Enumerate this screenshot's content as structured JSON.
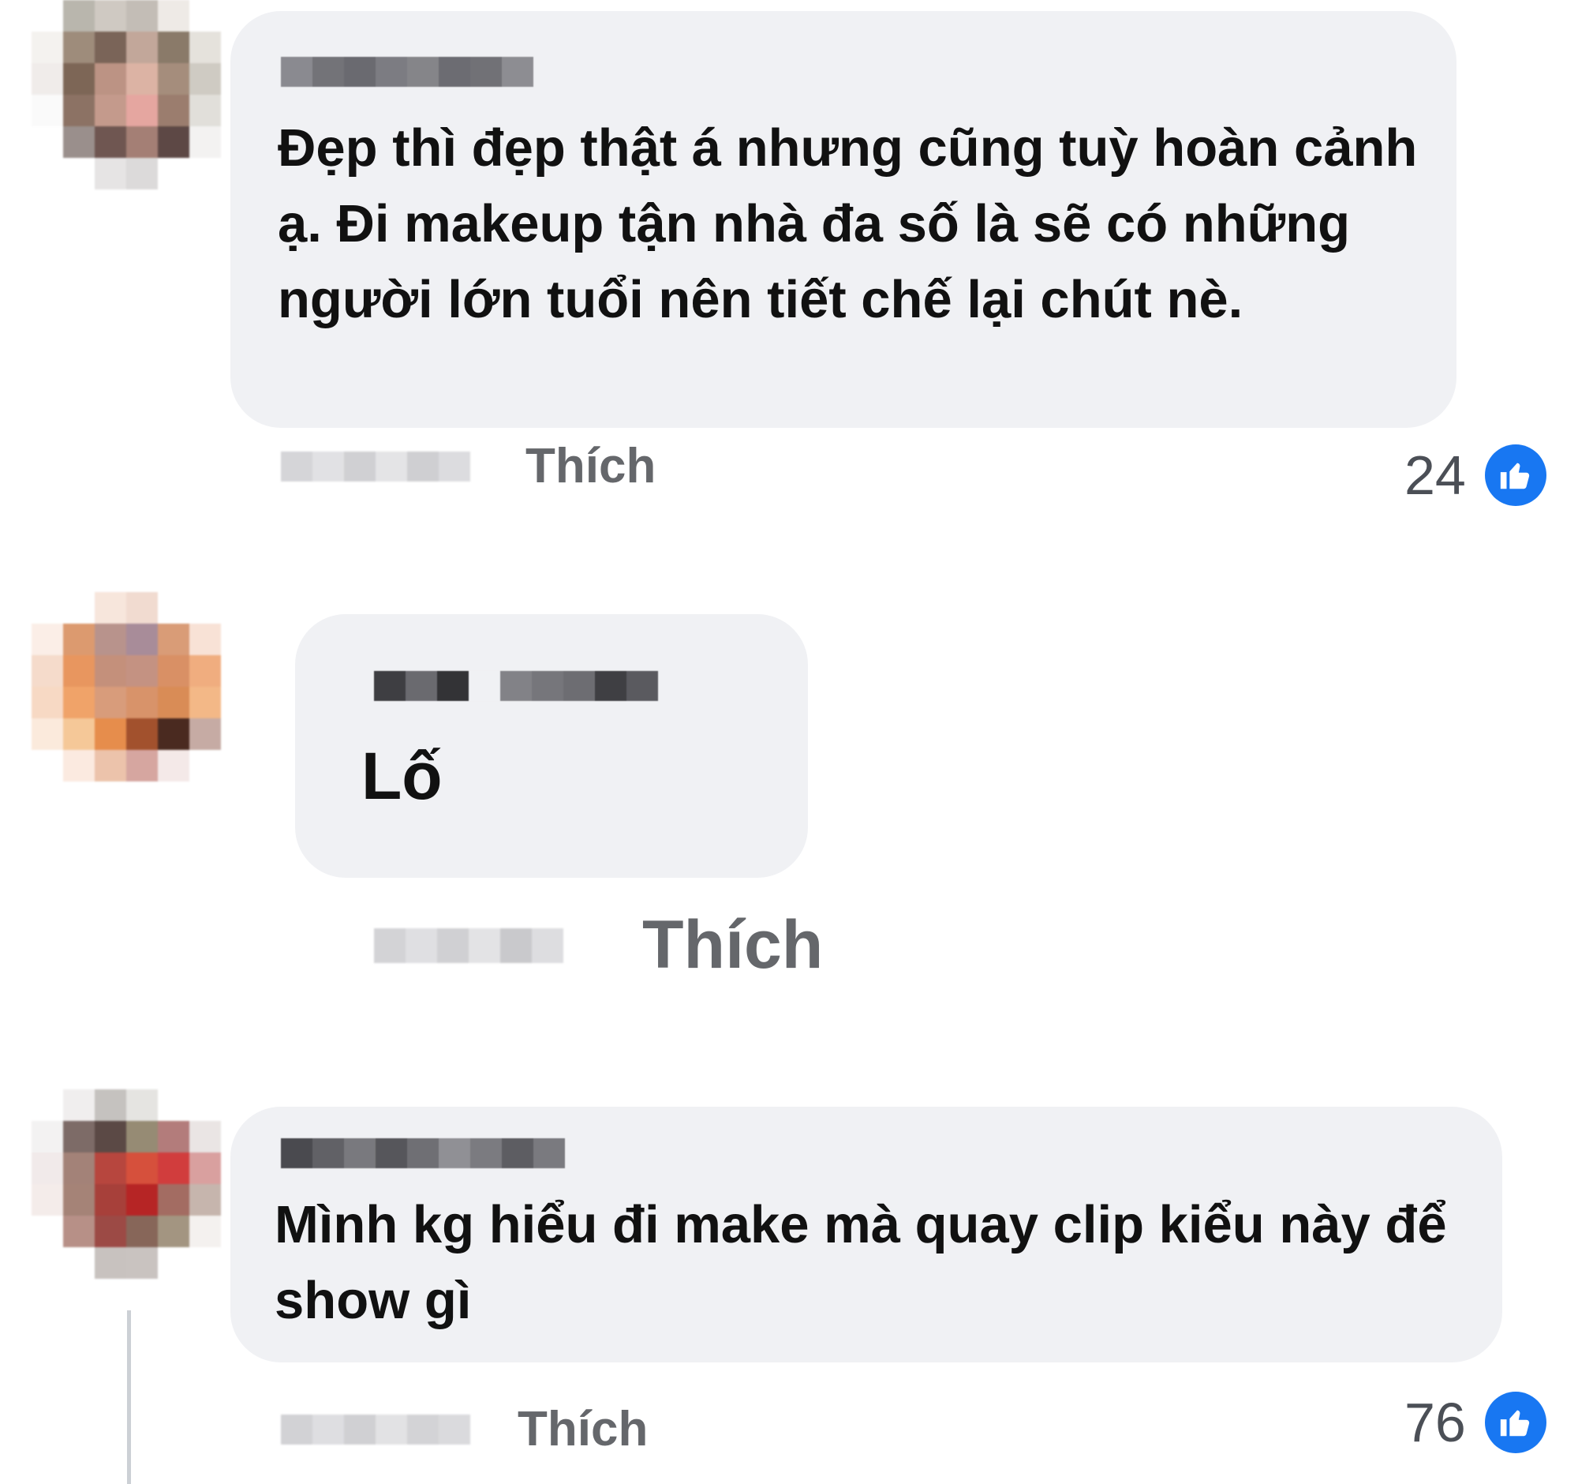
{
  "comments": [
    {
      "author": "",
      "text": "Đẹp thì đẹp thật á nhưng cũng tuỳ hoàn cảnh ạ. Đi makeup tận nhà đa số là sẽ có những người lớn tuổi nên tiết chế lại chút nè.",
      "like_label": "Thích",
      "reaction_count": "24",
      "reaction_icon": "like-icon"
    },
    {
      "author": "",
      "text": "Lố",
      "like_label": "Thích",
      "reaction_count": "",
      "reaction_icon": ""
    },
    {
      "author": "",
      "text": "Mình kg hiểu đi make mà quay clip kiểu này để show gì",
      "like_label": "Thích",
      "reaction_count": "76",
      "reaction_icon": "like-icon"
    }
  ],
  "colors": {
    "bubble_bg": "#f0f1f4",
    "text": "#111111",
    "action_text": "#65676b",
    "count_text": "#4b4f56",
    "like_blue": "#1877f2"
  }
}
